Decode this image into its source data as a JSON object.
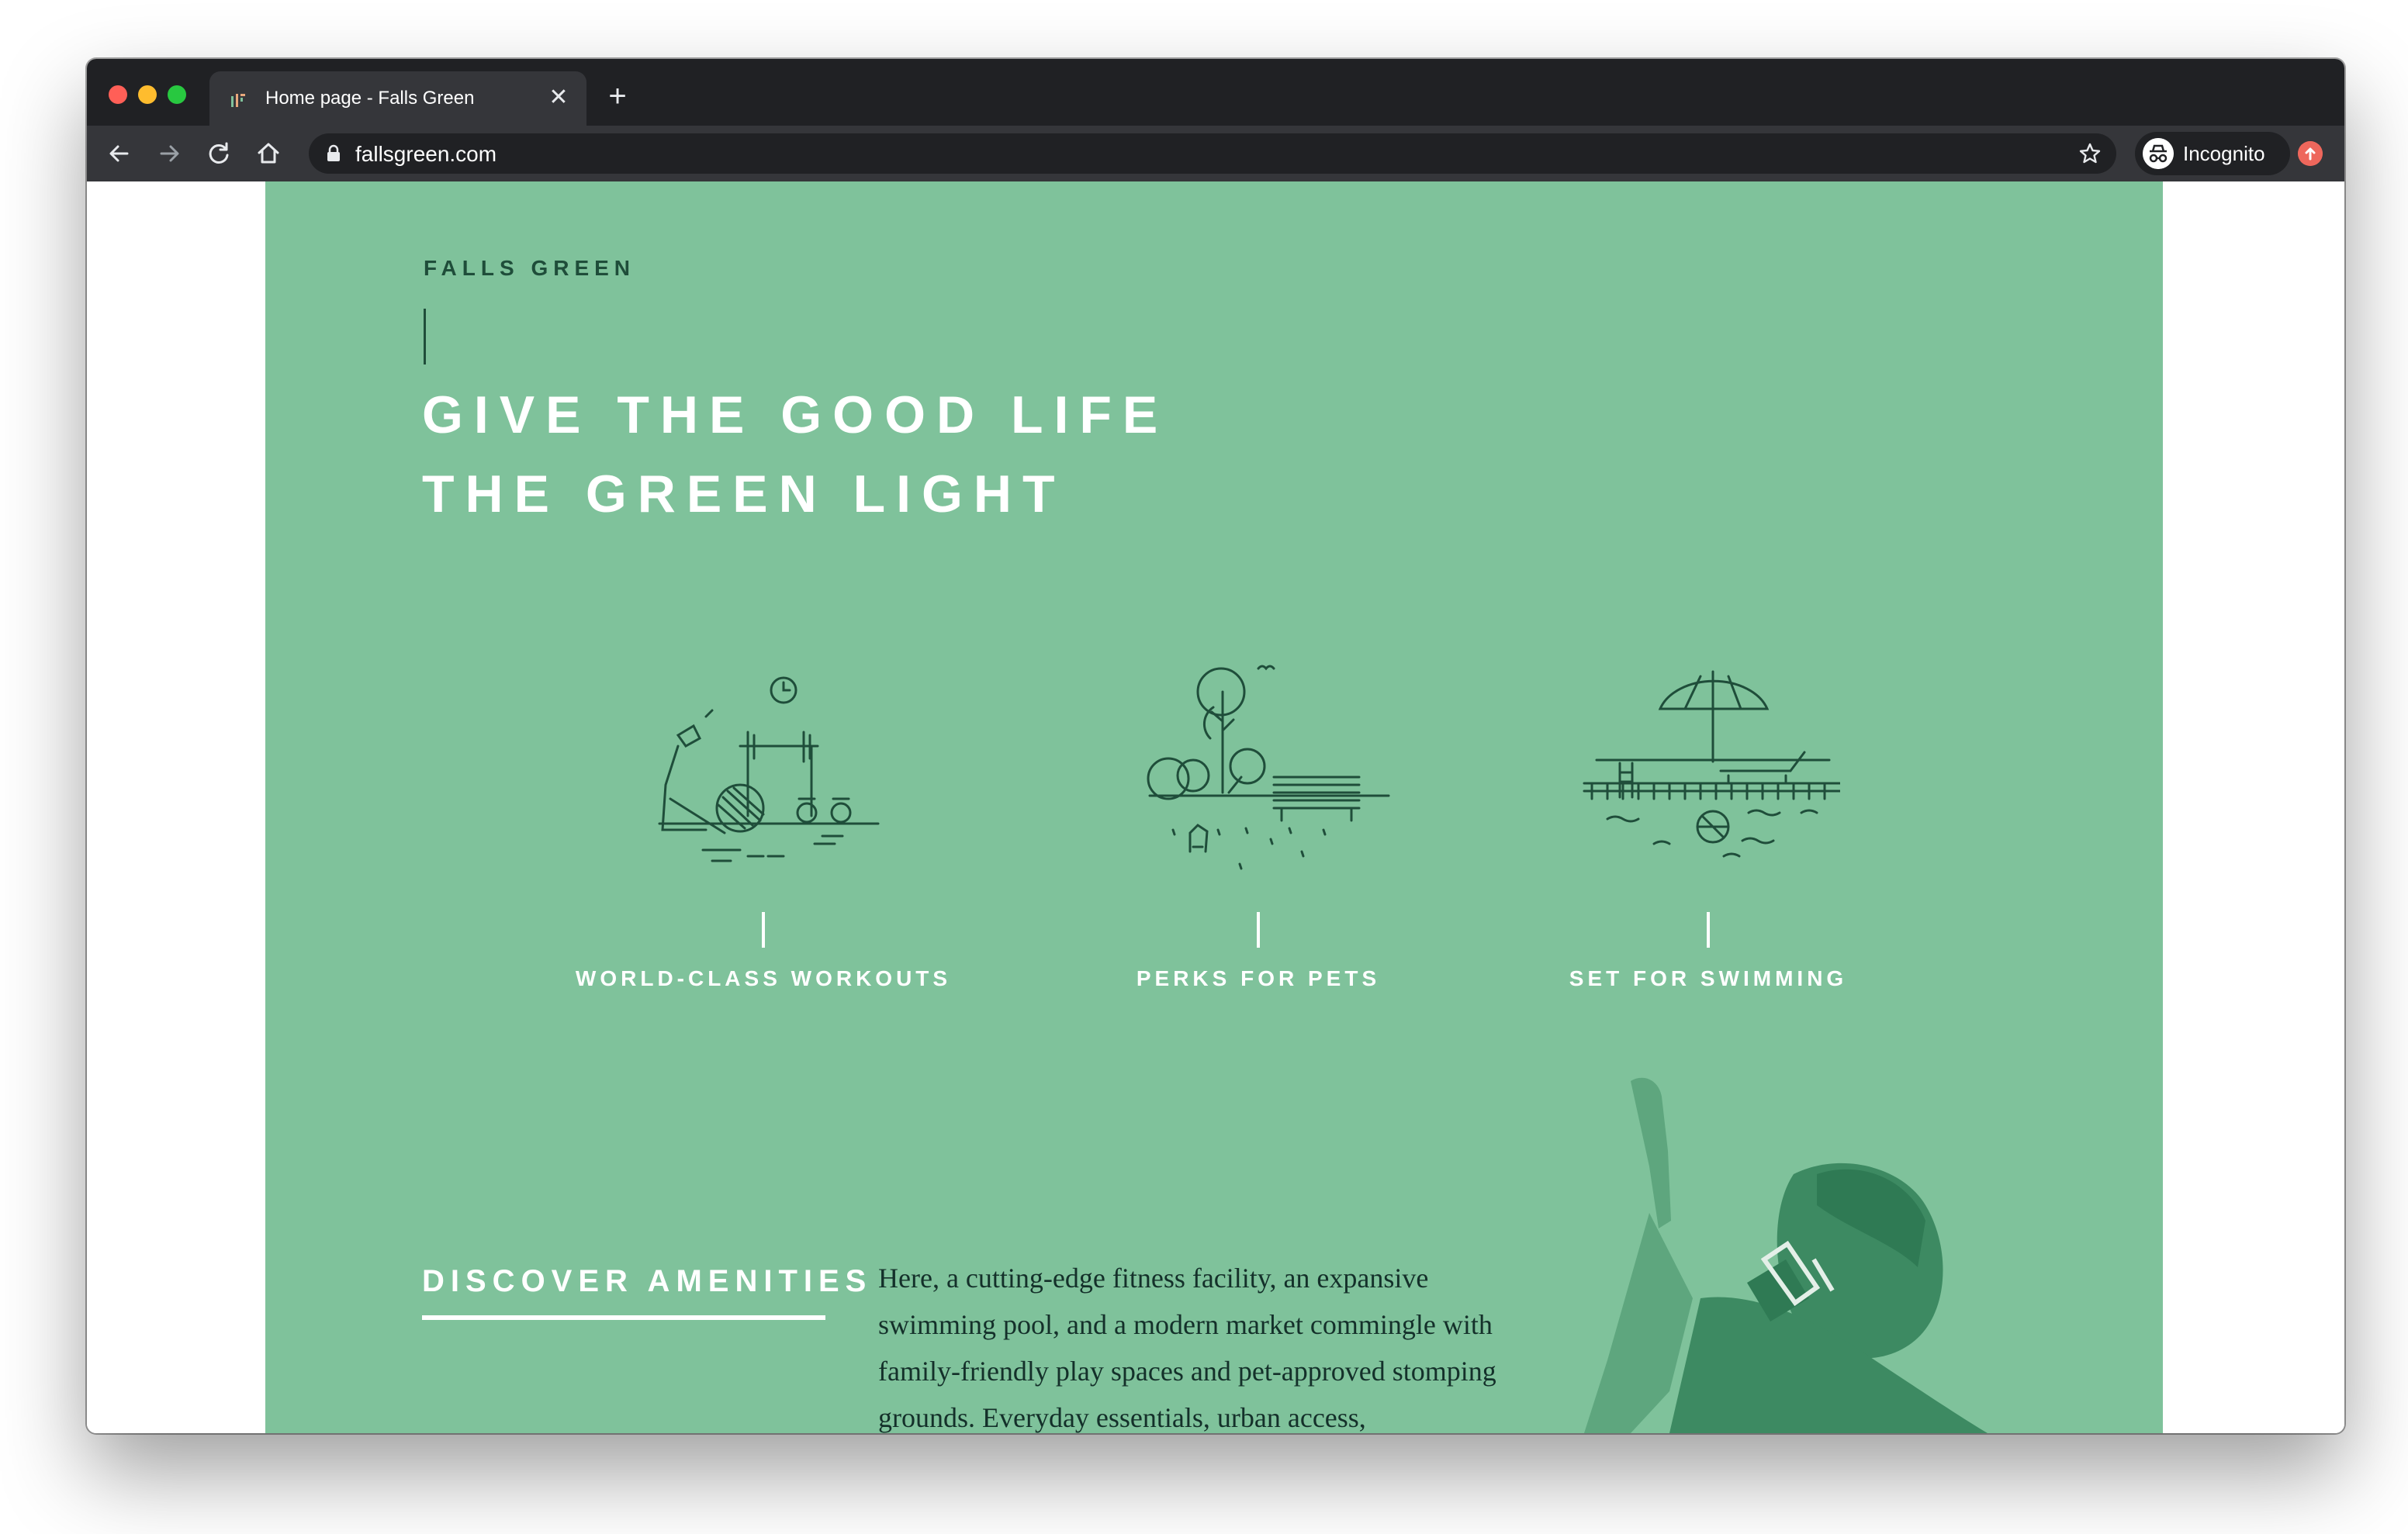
{
  "browser": {
    "tab_title": "Home page - Falls Green",
    "new_tab_label": "+",
    "close_tab_label": "✕",
    "url": "fallsgreen.com",
    "profile_label": "Incognito"
  },
  "page": {
    "brand": "FALLS GREEN",
    "headline_line1": "GIVE THE GOOD LIFE",
    "headline_line2": "THE GREEN LIGHT",
    "features": [
      {
        "label": "WORLD-CLASS WORKOUTS",
        "icon": "gym-illustration-icon"
      },
      {
        "label": "PERKS FOR PETS",
        "icon": "dog-park-illustration-icon"
      },
      {
        "label": "SET FOR SWIMMING",
        "icon": "pool-illustration-icon"
      }
    ],
    "discover_label": "DISCOVER AMENITIES",
    "body": "Here, a cutting-edge fitness facility, an expansive swimming pool, and a modern market commingle with family-friendly play spaces and pet-approved stomping grounds. Everyday essentials, urban access,"
  },
  "colors": {
    "hero_bg": "#7fc29b",
    "brand_dark": "#1f4d3a",
    "chrome_dark": "#202124",
    "chrome_mid": "#35363a"
  }
}
